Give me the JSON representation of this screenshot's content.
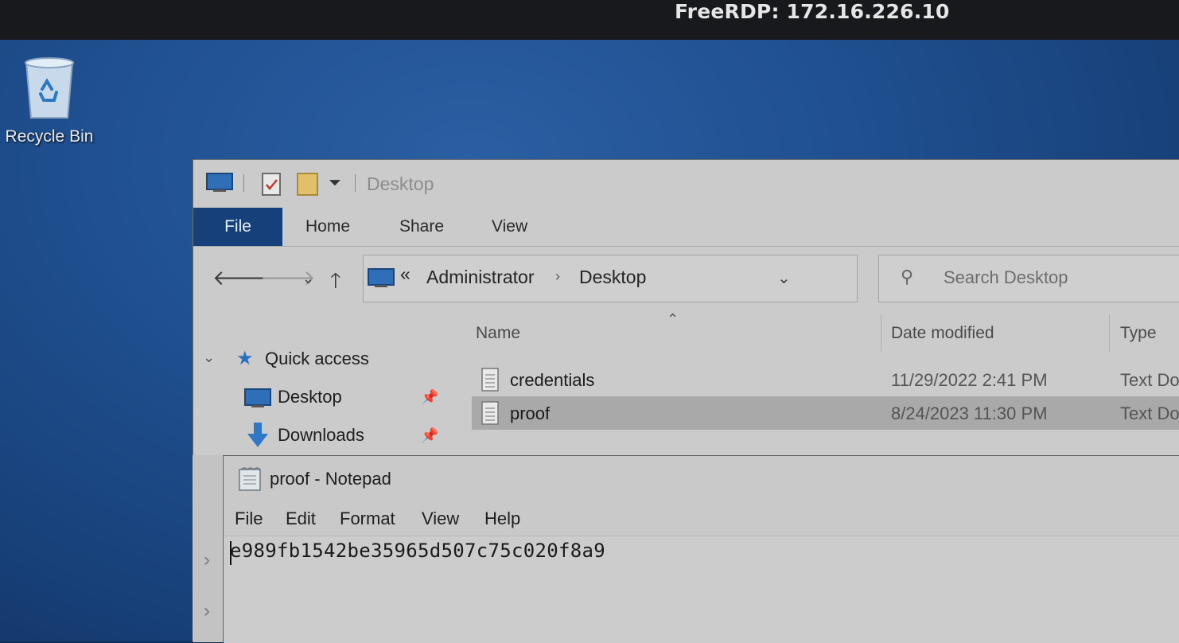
{
  "rdp": {
    "title": "FreeRDP: 172.16.226.10"
  },
  "desktop": {
    "recycle_bin_label": "Recycle Bin"
  },
  "explorer": {
    "title": "Desktop",
    "tabs": [
      "File",
      "Home",
      "Share",
      "View"
    ],
    "address": {
      "overflow": "«",
      "parts": [
        "Administrator",
        "Desktop"
      ]
    },
    "search_placeholder": "Search Desktop",
    "nav": {
      "quick_access": "Quick access",
      "items": [
        {
          "label": "Desktop",
          "pinned": true
        },
        {
          "label": "Downloads",
          "pinned": true
        }
      ]
    },
    "columns": [
      "Name",
      "Date modified",
      "Type"
    ],
    "files": [
      {
        "name": "credentials",
        "date": "11/29/2022 2:41 PM",
        "type": "Text Do",
        "selected": false
      },
      {
        "name": "proof",
        "date": "8/24/2023 11:30 PM",
        "type": "Text Do",
        "selected": true
      }
    ]
  },
  "notepad": {
    "title": "proof - Notepad",
    "menu": [
      "File",
      "Edit",
      "Format",
      "View",
      "Help"
    ],
    "content": "e989fb1542be35965d507c75c020f8a9"
  },
  "icons": {
    "recycle_bin": "recycle-bin-icon",
    "quick_access": "star-icon",
    "desktop": "desktop-folder-icon",
    "downloads": "download-arrow-icon",
    "pin": "pin-icon",
    "text_file": "text-file-icon",
    "notepad": "notepad-icon"
  },
  "colors": {
    "file_tab": "#16407a",
    "selected_row": "#a9a9a9",
    "desktop": "#1f4f8f"
  }
}
